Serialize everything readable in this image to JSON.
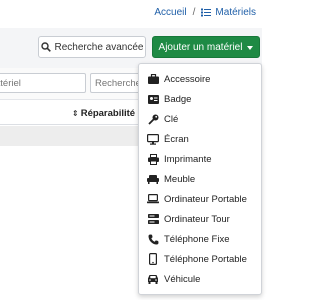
{
  "breadcrumb": {
    "home": "Accueil",
    "separator": "/",
    "current": "Matériels",
    "current_icon": "list-icon"
  },
  "toolbar": {
    "search_label": "Recherche avancée",
    "search_icon": "search-icon",
    "add_label": "Ajouter un matériel",
    "add_color": "#1e8a44"
  },
  "filters": {
    "input1_placeholder": "atériel",
    "input2_placeholder": "Recherche"
  },
  "table": {
    "column_reparabilite": "Réparabilité"
  },
  "menu": {
    "items": [
      {
        "label": "Accessoire",
        "icon": "briefcase-icon"
      },
      {
        "label": "Badge",
        "icon": "id-badge-icon"
      },
      {
        "label": "Clé",
        "icon": "key-icon"
      },
      {
        "label": "Écran",
        "icon": "monitor-icon"
      },
      {
        "label": "Imprimante",
        "icon": "printer-icon"
      },
      {
        "label": "Meuble",
        "icon": "furniture-icon"
      },
      {
        "label": "Ordinateur Portable",
        "icon": "laptop-icon"
      },
      {
        "label": "Ordinateur Tour",
        "icon": "server-icon"
      },
      {
        "label": "Téléphone Fixe",
        "icon": "phone-icon"
      },
      {
        "label": "Téléphone Portable",
        "icon": "mobile-icon"
      },
      {
        "label": "Véhicule",
        "icon": "car-icon"
      }
    ]
  }
}
